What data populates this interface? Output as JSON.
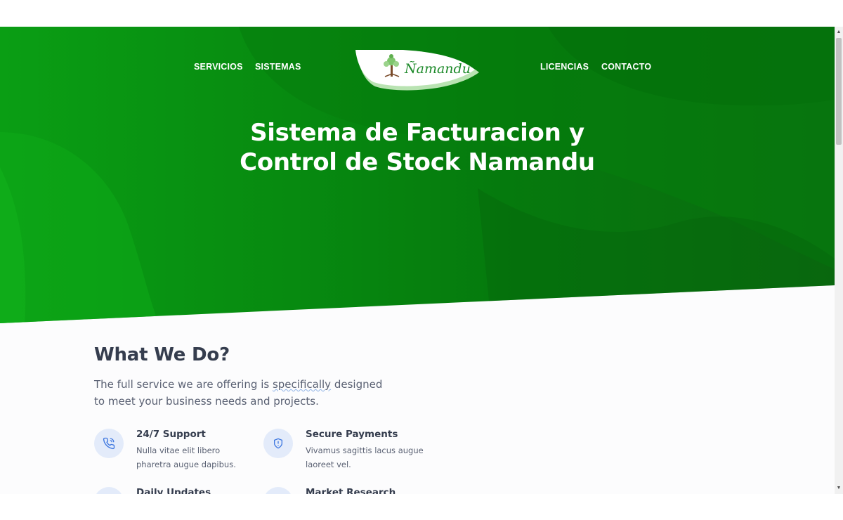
{
  "nav": {
    "left": [
      "SERVICIOS",
      "SISTEMAS"
    ],
    "right": [
      "LICENCIAS",
      "CONTACTO"
    ],
    "logo_text": "Ñamandu"
  },
  "hero": {
    "title_line1": "Sistema de Facturacion y",
    "title_line2": "Control de Stock Namandu"
  },
  "section": {
    "title": "What We Do?",
    "desc_before": "The full service we are offering is ",
    "desc_spell": "specifically",
    "desc_after": " designed to meet your business needs and projects."
  },
  "features": [
    {
      "icon": "phone-icon",
      "title": "24/7 Support",
      "desc": "Nulla vitae elit libero pharetra augue dapibus."
    },
    {
      "icon": "shield-icon",
      "title": "Secure Payments",
      "desc": "Vivamus sagittis lacus augue laoreet vel."
    },
    {
      "icon": "update-icon",
      "title": "Daily Updates",
      "desc": ""
    },
    {
      "icon": "chart-icon",
      "title": "Market Research",
      "desc": ""
    }
  ],
  "colors": {
    "hero_green": "#078a10",
    "hero_dark": "#0b6b10",
    "heading": "#353d4e",
    "text": "#5a6173",
    "icon_bg": "#e3ebfa",
    "icon_fg": "#3f78e0"
  }
}
